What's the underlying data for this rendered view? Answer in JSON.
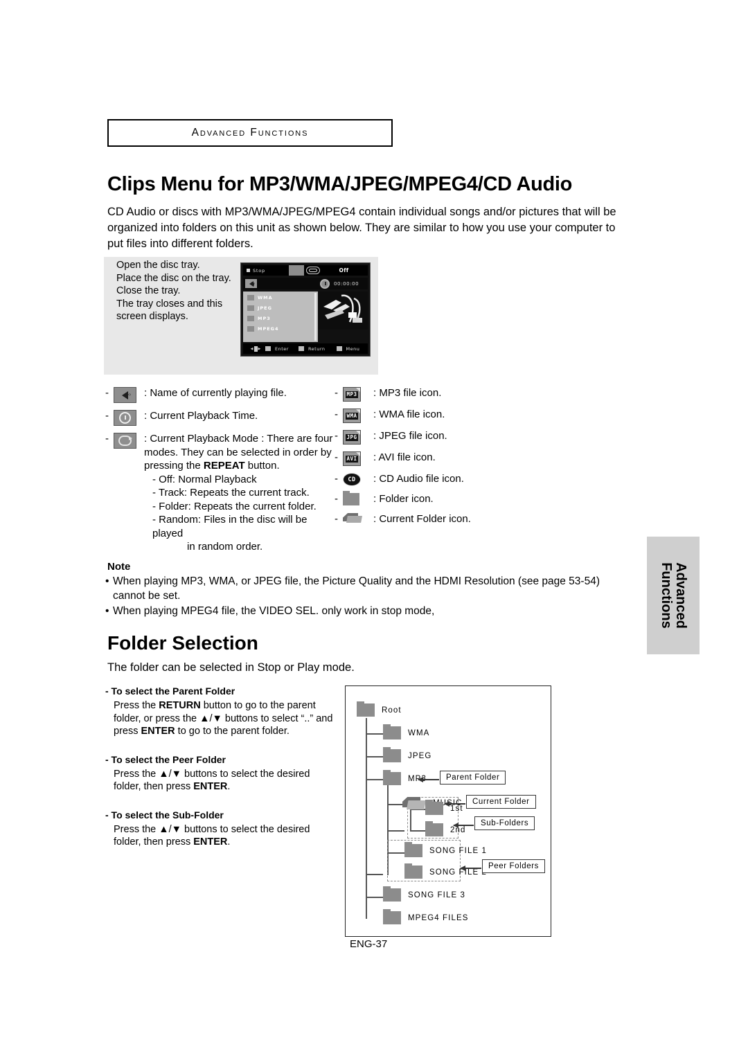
{
  "chapter": {
    "label": "Advanced Functions"
  },
  "main": {
    "title": "Clips Menu for MP3/WMA/JPEG/MPEG4/CD Audio",
    "intro": "CD Audio or discs with MP3/WMA/JPEG/MPEG4 contain individual songs and/or pictures that will be organized into folders on this unit as shown below.  They are similar to how you use your computer to put files into different folders."
  },
  "figure": {
    "steps": "Open the disc tray.\nPlace the disc on the tray.\nClose the tray.\nThe tray closes and this screen displays.",
    "screen": {
      "status": "Stop",
      "mode_value": "Off",
      "time": "00:00:00",
      "file_list": [
        "WMA",
        "JPEG",
        "MP3",
        "MPEG4"
      ],
      "nav": {
        "enter": "Enter",
        "return": "Return",
        "menu": "Menu"
      }
    }
  },
  "legend_left": [
    {
      "icon": "speaker-icon",
      "text": ": Name of currently playing file."
    },
    {
      "icon": "clock-icon",
      "text": ": Current Playback Time."
    },
    {
      "icon": "repeat-icon",
      "text": ": Current Playback Mode : There are four modes. They can be selected in order by pressing the REPEAT button.",
      "modes": [
        "- Off: Normal Playback",
        "- Track: Repeats the current track.",
        "- Folder: Repeats the current folder.",
        "- Random: Files in the disc will be played",
        "in random order."
      ]
    }
  ],
  "legend_right": [
    {
      "icon": "mp3-file-icon",
      "tag": "MP3",
      "text": ": MP3 file icon."
    },
    {
      "icon": "wma-file-icon",
      "tag": "WMA",
      "text": ": WMA file icon."
    },
    {
      "icon": "jpg-file-icon",
      "tag": "JPG",
      "text": ": JPEG file icon."
    },
    {
      "icon": "avi-file-icon",
      "tag": "AVI",
      "text": ": AVI file icon."
    },
    {
      "icon": "cd-audio-icon",
      "tag": "CD",
      "text": ": CD Audio  file icon."
    },
    {
      "icon": "folder-icon",
      "tag": "",
      "text": ": Folder icon."
    },
    {
      "icon": "current-folder-icon",
      "tag": "",
      "text": ": Current Folder icon."
    }
  ],
  "note": {
    "title": "Note",
    "bullets": [
      "When playing MP3, WMA, or JPEG file, the Picture Quality  and the HDMI Resolution (see page 53-54) cannot be set.",
      "When playing MPEG4 file, the VIDEO SEL. only work in stop mode,"
    ]
  },
  "side_tab": {
    "line1": "Advanced",
    "line2": "Functions"
  },
  "folder_selection": {
    "title": "Folder Selection",
    "subtitle": "The folder can be selected in Stop or Play mode.",
    "blocks": [
      {
        "head": "- To select the Parent Folder",
        "body": "Press the RETURN button to go to the parent folder, or press the ▲/▼ buttons to select “..” and press ENTER to go to the parent folder."
      },
      {
        "head": "- To select the Peer Folder",
        "body": "Press the ▲/▼ buttons to select the desired folder, then press ENTER."
      },
      {
        "head": "- To select the Sub-Folder",
        "body": "Press the ▲/▼ buttons to select the desired folder, then press ENTER."
      }
    ]
  },
  "tree": {
    "nodes": [
      {
        "label": "Root"
      },
      {
        "label": "WMA"
      },
      {
        "label": "JPEG"
      },
      {
        "label": "MP3"
      },
      {
        "label": "MUSIC"
      },
      {
        "label": "1st"
      },
      {
        "label": "2nd"
      },
      {
        "label": "SONG FILE 1"
      },
      {
        "label": "SONG FILE 2"
      },
      {
        "label": "SONG FILE 3"
      },
      {
        "label": "MPEG4 FILES"
      }
    ],
    "callouts": [
      {
        "label": "Parent Folder"
      },
      {
        "label": "Current Folder"
      },
      {
        "label": "Sub-Folders"
      },
      {
        "label": "Peer Folders"
      }
    ]
  },
  "footer": {
    "page": "ENG-37"
  }
}
